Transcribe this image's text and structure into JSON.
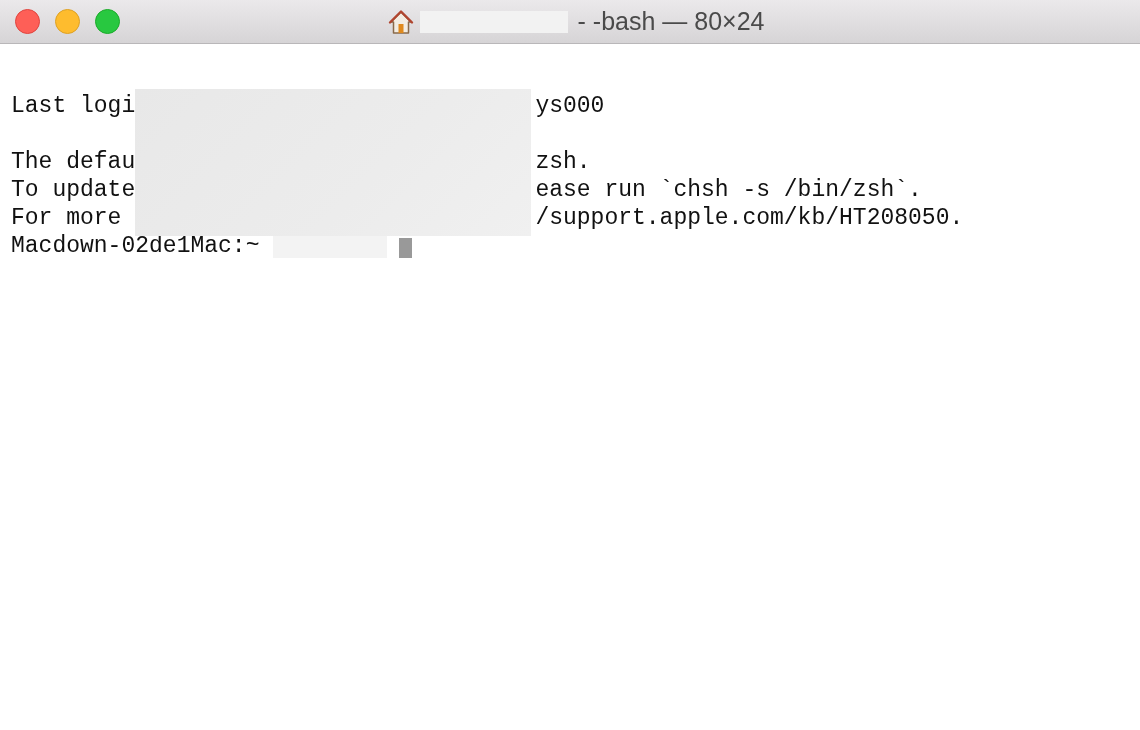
{
  "window": {
    "title": "- -bash — 80×24",
    "title_masked": true
  },
  "terminal": {
    "lines": [
      {
        "kind": "masked",
        "start": "Last logi",
        "end": "ys000"
      },
      {
        "kind": "masked"
      },
      {
        "kind": "masked",
        "start": "The defau",
        "end": "zsh."
      },
      {
        "kind": "masked",
        "start": "To update",
        "end": "ease run `chsh -s /bin/zsh`."
      },
      {
        "kind": "masked",
        "start": "For more ",
        "end": "/support.apple.com/kb/HT208050."
      },
      {
        "kind": "prompt",
        "start": "Macdown-02de1Mac:~",
        "masked": true,
        "cursor": true
      }
    ]
  }
}
